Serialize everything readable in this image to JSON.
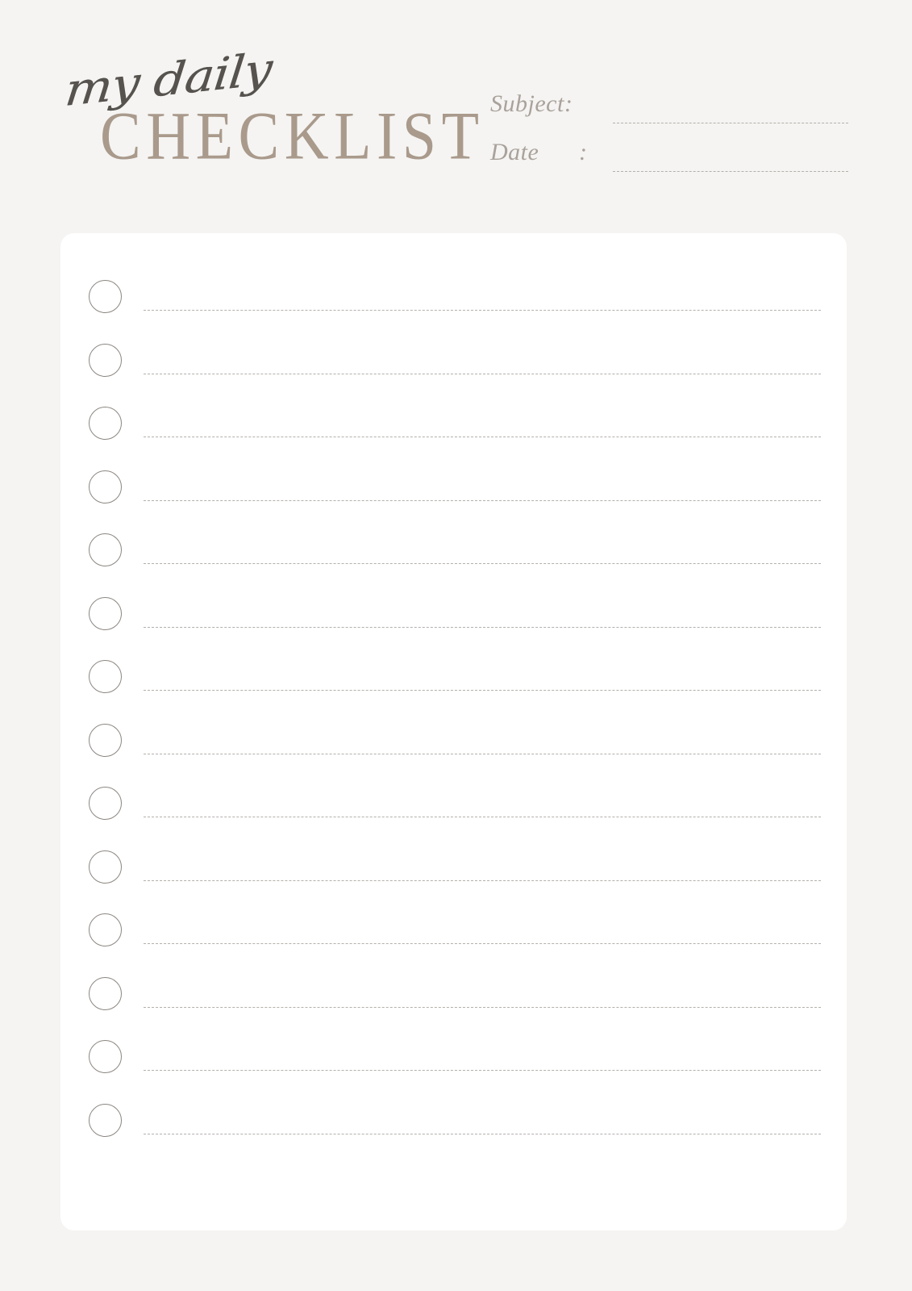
{
  "page": {
    "background_color": "#f5f4f2",
    "card_color": "#ffffff",
    "accent_color": "#a99a8c",
    "script_color": "#56534f",
    "label_color": "#a9a29b",
    "line_color": "#b4b0ab",
    "circle_color": "#8c8681"
  },
  "header": {
    "title_script": "my daily",
    "title_main": "CHECKLIST",
    "meta": [
      {
        "label": "Subject",
        "colon": ":",
        "value": "",
        "placeholder": ""
      },
      {
        "label": "Date",
        "colon": ":",
        "value": "",
        "placeholder": ""
      }
    ]
  },
  "checklist": {
    "item_count": 14,
    "items": [
      {
        "checked": false,
        "text": ""
      },
      {
        "checked": false,
        "text": ""
      },
      {
        "checked": false,
        "text": ""
      },
      {
        "checked": false,
        "text": ""
      },
      {
        "checked": false,
        "text": ""
      },
      {
        "checked": false,
        "text": ""
      },
      {
        "checked": false,
        "text": ""
      },
      {
        "checked": false,
        "text": ""
      },
      {
        "checked": false,
        "text": ""
      },
      {
        "checked": false,
        "text": ""
      },
      {
        "checked": false,
        "text": ""
      },
      {
        "checked": false,
        "text": ""
      },
      {
        "checked": false,
        "text": ""
      },
      {
        "checked": false,
        "text": ""
      }
    ]
  }
}
